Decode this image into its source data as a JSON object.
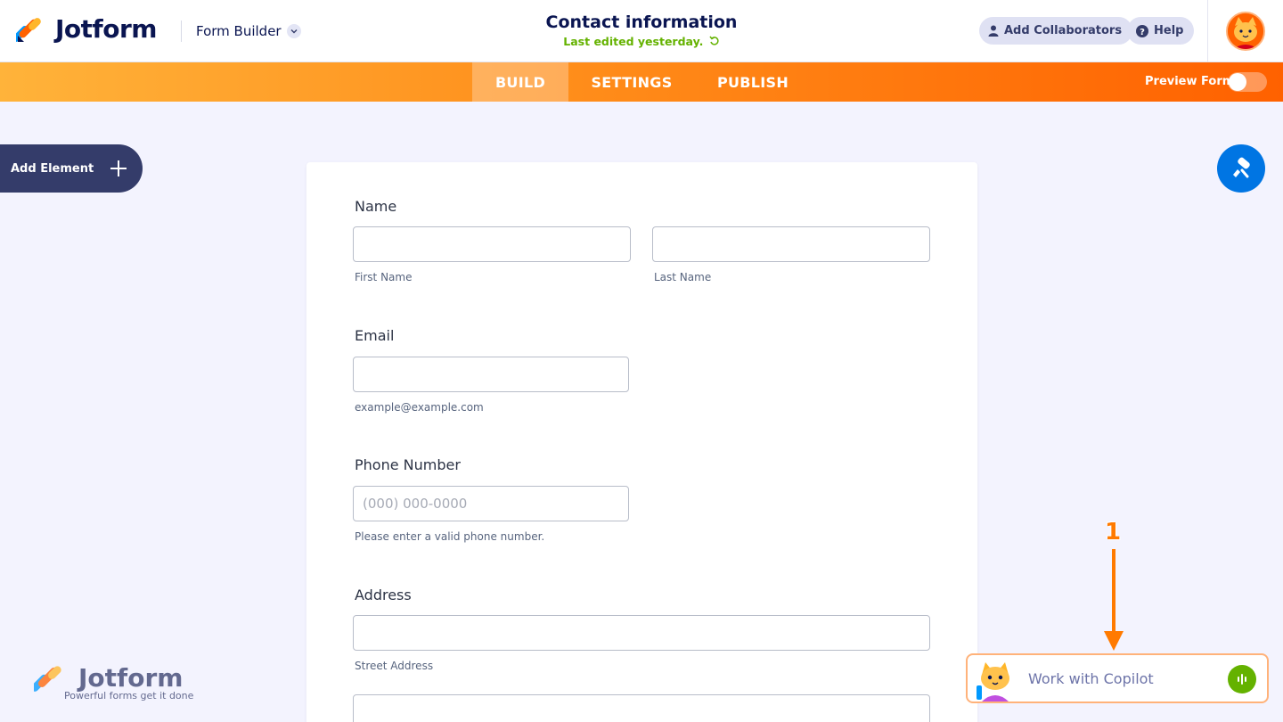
{
  "header": {
    "brand": "Jotform",
    "builder_label": "Form Builder",
    "form_title": "Contact information",
    "last_edited": "Last edited yesterday.",
    "add_collaborators": "Add Collaborators",
    "help": "Help"
  },
  "nav": {
    "tabs": [
      {
        "label": "BUILD",
        "active": true
      },
      {
        "label": "SETTINGS",
        "active": false
      },
      {
        "label": "PUBLISH",
        "active": false
      }
    ],
    "preview_label": "Preview Form",
    "preview_on": false
  },
  "sidebar": {
    "add_element": "Add Element"
  },
  "form": {
    "name": {
      "label": "Name",
      "first_sub": "First Name",
      "last_sub": "Last Name"
    },
    "email": {
      "label": "Email",
      "sub": "example@example.com"
    },
    "phone": {
      "label": "Phone Number",
      "placeholder": "(000) 000-0000",
      "sub": "Please enter a valid phone number."
    },
    "address": {
      "label": "Address",
      "street_sub": "Street Address"
    }
  },
  "watermark": {
    "brand": "Jotform",
    "tagline": "Powerful forms get it done"
  },
  "annotation": {
    "number": "1"
  },
  "copilot": {
    "label": "Work with Copilot"
  },
  "colors": {
    "navy": "#0a1551",
    "orange": "#ff6100",
    "blue": "#0075e3",
    "green": "#64b200"
  }
}
